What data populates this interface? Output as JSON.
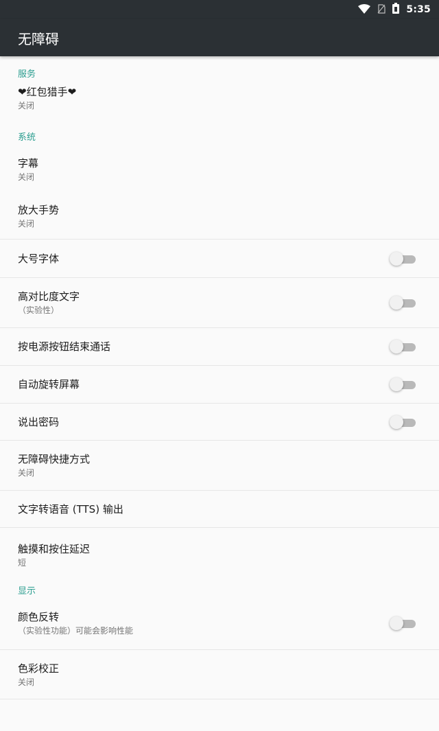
{
  "status_bar": {
    "time": "5:35",
    "icons": [
      "wifi-icon",
      "no-sim-icon",
      "battery-icon"
    ]
  },
  "app_bar": {
    "title": "无障碍"
  },
  "sections": [
    {
      "header": "服务",
      "items": [
        {
          "title": "❤红包猎手❤",
          "summary": "关闭",
          "toggle": null
        }
      ]
    },
    {
      "header": "系统",
      "items": [
        {
          "title": "字幕",
          "summary": "关闭",
          "toggle": null
        },
        {
          "title": "放大手势",
          "summary": "关闭",
          "toggle": null
        },
        {
          "title": "大号字体",
          "summary": "",
          "toggle": "off"
        },
        {
          "title": "高对比度文字",
          "summary": "（实验性）",
          "toggle": "off"
        },
        {
          "title": "按电源按钮结束通话",
          "summary": "",
          "toggle": "off"
        },
        {
          "title": "自动旋转屏幕",
          "summary": "",
          "toggle": "off"
        },
        {
          "title": "说出密码",
          "summary": "",
          "toggle": "off"
        },
        {
          "title": "无障碍快捷方式",
          "summary": "关闭",
          "toggle": null
        },
        {
          "title": "文字转语音 (TTS) 输出",
          "summary": "",
          "toggle": null
        },
        {
          "title": "触摸和按住延迟",
          "summary": "短",
          "toggle": null
        }
      ]
    },
    {
      "header": "显示",
      "items": [
        {
          "title": "颜色反转",
          "summary": "（实验性功能）可能会影响性能",
          "toggle": "off"
        },
        {
          "title": "色彩校正",
          "summary": "关闭",
          "toggle": null
        }
      ]
    }
  ],
  "colors": {
    "accent": "#2a9d8f",
    "toolbar": "#2b3034",
    "background": "#fafafa",
    "divider": "#e6e6e6",
    "switch_off_track": "#b9b9b9",
    "switch_off_thumb": "#f1f1f1"
  }
}
